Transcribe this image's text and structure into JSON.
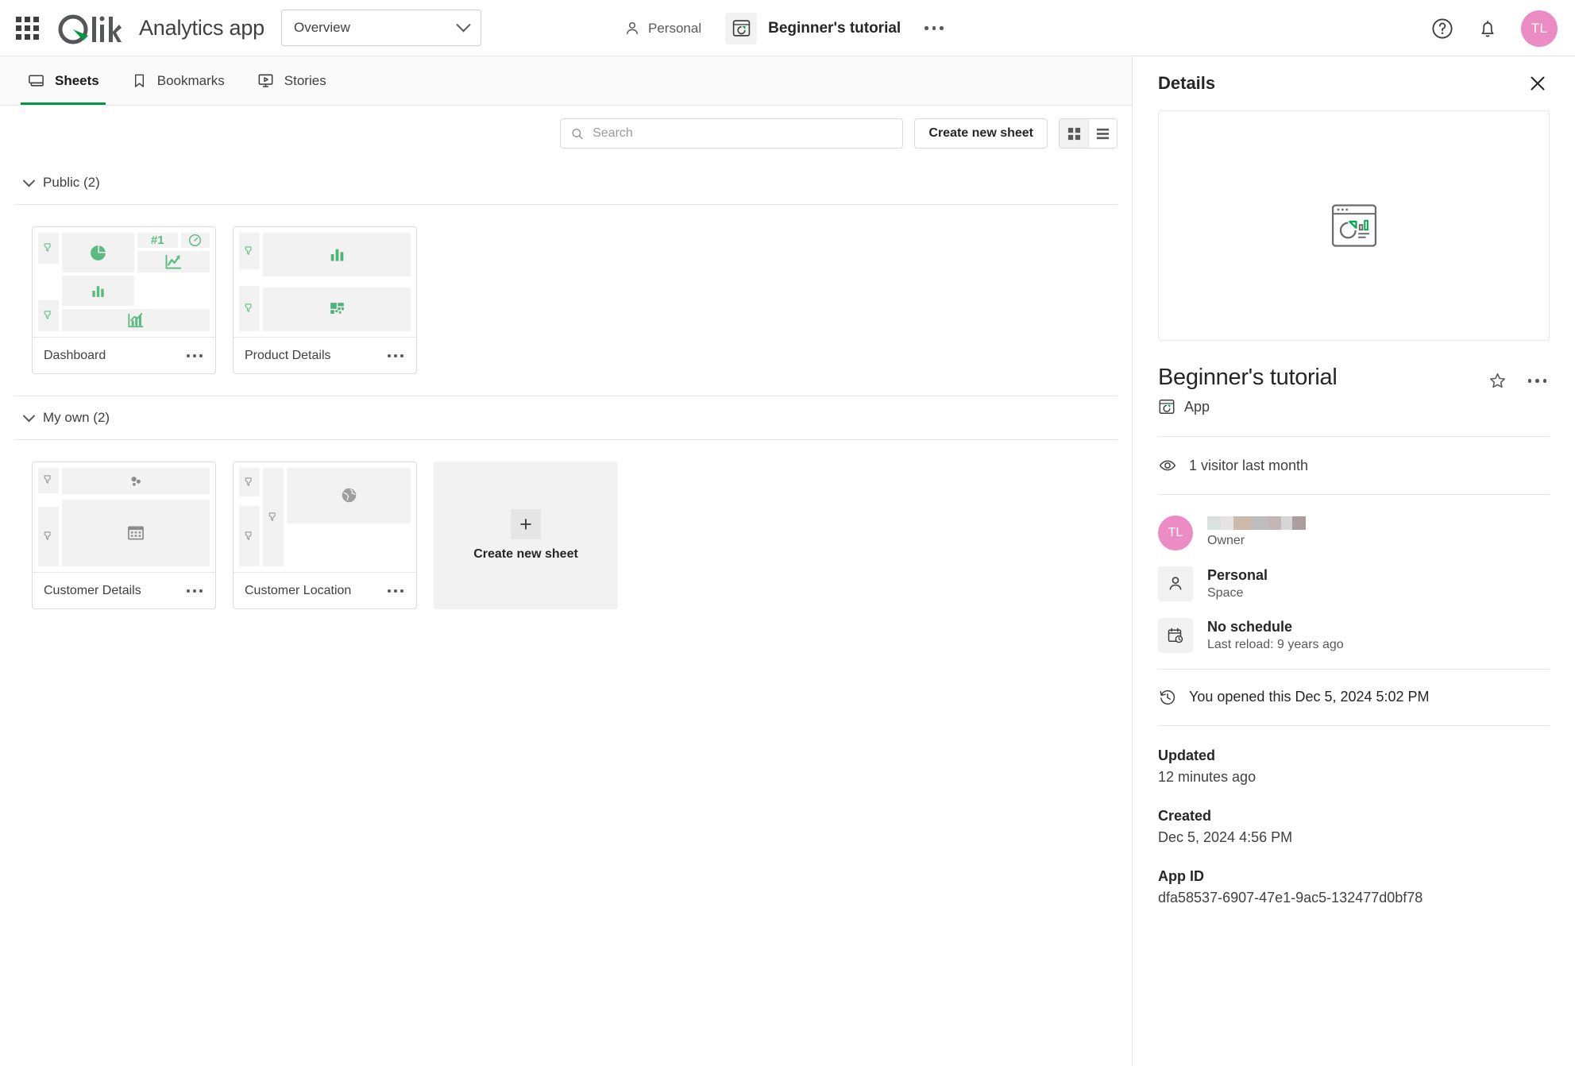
{
  "topbar": {
    "waffle_icon": "apps-grid-icon",
    "brand": "Qlik",
    "app_title": "Analytics app",
    "overview_label": "Overview",
    "space_label": "Personal",
    "app_name": "Beginner's tutorial",
    "more_label": "…",
    "help_icon": "help-circle-icon",
    "bell_icon": "notification-bell-icon",
    "avatar_initials": "TL",
    "avatar_color": "#ec8cc4"
  },
  "tabs": [
    {
      "label": "Sheets",
      "icon": "sheet-icon",
      "active": true
    },
    {
      "label": "Bookmarks",
      "icon": "bookmark-icon",
      "active": false
    },
    {
      "label": "Stories",
      "icon": "story-icon",
      "active": false
    }
  ],
  "toolbar": {
    "search_placeholder": "Search",
    "search_value": "",
    "create_sheet_label": "Create new sheet",
    "view_grid_icon": "grid-view-icon",
    "view_list_icon": "list-view-icon",
    "view_selected": "grid"
  },
  "sections": [
    {
      "title": "Public (2)",
      "count": 2,
      "sheets": [
        {
          "name": "Dashboard",
          "accent": "#6ec48d"
        },
        {
          "name": "Product Details",
          "accent": "#5cbb82"
        }
      ]
    },
    {
      "title": "My own (2)",
      "count": 2,
      "sheets": [
        {
          "name": "Customer Details",
          "accent": "#9e9e9e"
        },
        {
          "name": "Customer Location",
          "accent": "#9e9e9e"
        }
      ],
      "create_card_label": "Create new sheet"
    }
  ],
  "details": {
    "panel_title": "Details",
    "close_icon": "close-icon",
    "preview_icon": "app-preview-icon",
    "app_name": "Beginner's tutorial",
    "favorite_icon": "star-outline-icon",
    "more_icon": "more-horizontal-icon",
    "type_icon": "app-icon",
    "type_label": "App",
    "visitors_icon": "eye-icon",
    "visitors_label": "1 visitor last month",
    "owner": {
      "avatar_initials": "TL",
      "avatar_color": "#ec8cc4",
      "name_redacted": true,
      "role_label": "Owner"
    },
    "space": {
      "icon": "person-icon",
      "title": "Personal",
      "subtitle": "Space"
    },
    "schedule": {
      "icon": "calendar-clock-icon",
      "title": "No schedule",
      "subtitle": "Last reload: 9 years ago"
    },
    "opened": {
      "icon": "history-clock-icon",
      "label": "You opened this Dec 5, 2024 5:02 PM"
    },
    "fields": [
      {
        "key": "Updated",
        "value": "12 minutes ago"
      },
      {
        "key": "Created",
        "value": "Dec 5, 2024 4:56 PM"
      },
      {
        "key": "App ID",
        "value": "dfa58537-6907-47e1-9ac5-132477d0bf78"
      }
    ]
  }
}
